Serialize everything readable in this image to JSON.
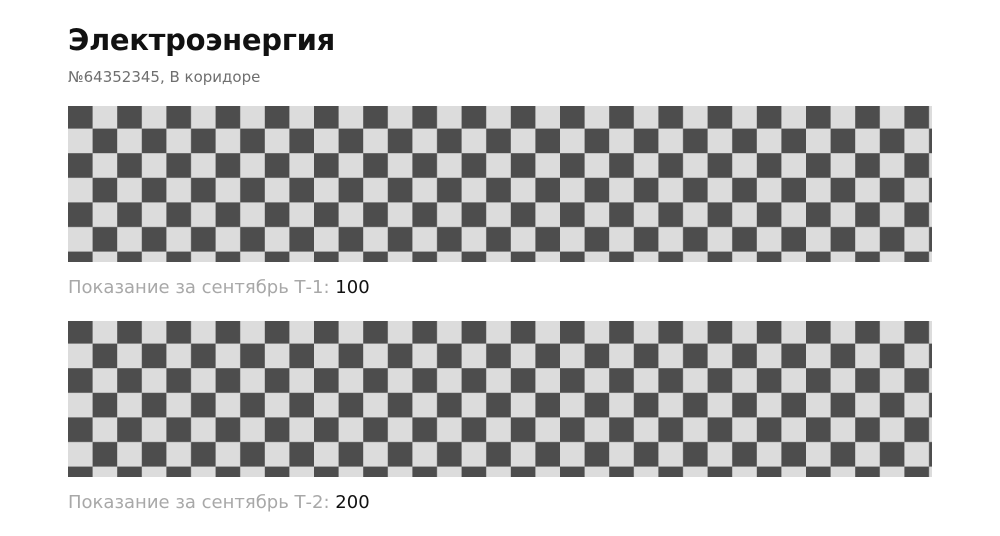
{
  "header": {
    "title": "Электроэнергия",
    "subtitle": "№64352345, В коридоре"
  },
  "readings": [
    {
      "label": "Показание за сентябрь Т-1:",
      "value": "100",
      "image_icon": "checkerboard-placeholder-icon"
    },
    {
      "label": "Показание за сентябрь Т-2:",
      "value": "200",
      "image_icon": "checkerboard-placeholder-icon"
    }
  ],
  "colors": {
    "checker_dark": "#4d4d4d",
    "checker_light": "#dcdcdc",
    "title": "#111111",
    "subtitle": "#6f6f6f",
    "label": "#a8a8a8",
    "value": "#111111"
  }
}
